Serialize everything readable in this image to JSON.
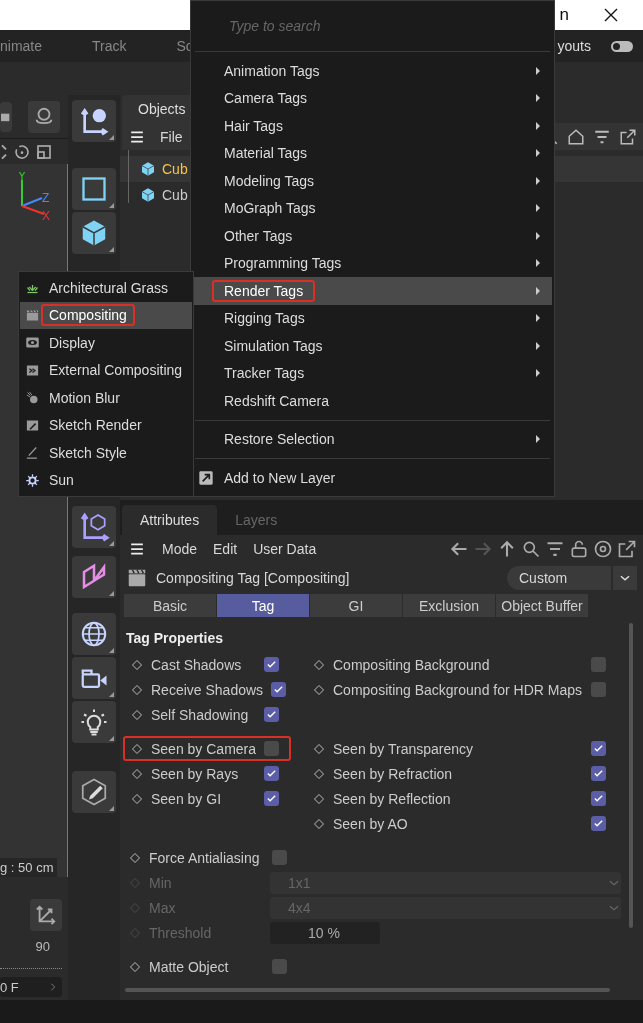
{
  "window": {
    "title": "n"
  },
  "menu_bar": {
    "items": [
      "nimate",
      "Track",
      "Sc"
    ],
    "right_label": "youts",
    "toggle": {
      "on": false
    }
  },
  "viewport": {
    "axis_labels": [
      "Y",
      "Z",
      "X"
    ],
    "grid_label": "g : 50 cm"
  },
  "timeline": {
    "tick_label": "90",
    "frame_field": "0 F"
  },
  "objects_panel": {
    "tab": "Objects",
    "menu": [
      "File"
    ],
    "objects": [
      {
        "name": "Cub",
        "selected": true
      },
      {
        "name": "Cub",
        "selected": false
      }
    ]
  },
  "context_menu": {
    "placeholder": "Type to search",
    "items": [
      {
        "kind": "submenu",
        "label": "Animation Tags",
        "selected": false,
        "annotated": false
      },
      {
        "kind": "submenu",
        "label": "Camera Tags",
        "selected": false,
        "annotated": false
      },
      {
        "kind": "submenu",
        "label": "Hair Tags",
        "selected": false,
        "annotated": false
      },
      {
        "kind": "submenu",
        "label": "Material Tags",
        "selected": false,
        "annotated": false
      },
      {
        "kind": "submenu",
        "label": "Modeling Tags",
        "selected": false,
        "annotated": false
      },
      {
        "kind": "submenu",
        "label": "MoGraph Tags",
        "selected": false,
        "annotated": false
      },
      {
        "kind": "submenu",
        "label": "Other Tags",
        "selected": false,
        "annotated": false
      },
      {
        "kind": "submenu",
        "label": "Programming Tags",
        "selected": false,
        "annotated": false
      },
      {
        "kind": "submenu",
        "label": "Render Tags",
        "selected": true,
        "annotated": true
      },
      {
        "kind": "submenu",
        "label": "Rigging Tags",
        "selected": false,
        "annotated": false
      },
      {
        "kind": "submenu",
        "label": "Simulation Tags",
        "selected": false,
        "annotated": false
      },
      {
        "kind": "submenu",
        "label": "Tracker Tags",
        "selected": false,
        "annotated": false
      },
      {
        "kind": "action",
        "label": "Redshift Camera",
        "selected": false,
        "annotated": false
      },
      {
        "kind": "separator"
      },
      {
        "kind": "submenu",
        "label": "Restore Selection",
        "selected": false,
        "annotated": false
      },
      {
        "kind": "separator"
      },
      {
        "kind": "action",
        "label": "Add to New Layer",
        "selected": false,
        "annotated": false
      }
    ]
  },
  "render_submenu": {
    "items": [
      {
        "label": "Architectural Grass",
        "selected": false,
        "annotated": false
      },
      {
        "label": "Compositing",
        "selected": true,
        "annotated": true
      },
      {
        "label": "Display",
        "selected": false,
        "annotated": false
      },
      {
        "label": "External Compositing",
        "selected": false,
        "annotated": false
      },
      {
        "label": "Motion Blur",
        "selected": false,
        "annotated": false
      },
      {
        "label": "Sketch Render",
        "selected": false,
        "annotated": false
      },
      {
        "label": "Sketch Style",
        "selected": false,
        "annotated": false
      },
      {
        "label": "Sun",
        "selected": false,
        "annotated": false
      }
    ]
  },
  "attributes_panel": {
    "tabs": [
      {
        "label": "Attributes",
        "selected": true
      },
      {
        "label": "Layers",
        "selected": false
      }
    ],
    "menu": [
      "Mode",
      "Edit",
      "User Data"
    ],
    "title": "Compositing Tag [Compositing]",
    "preset": "Custom",
    "page_tabs": [
      {
        "label": "Basic",
        "selected": false
      },
      {
        "label": "Tag",
        "selected": true
      },
      {
        "label": "GI",
        "selected": false
      },
      {
        "label": "Exclusion",
        "selected": false
      },
      {
        "label": "Object Buffer",
        "selected": false
      }
    ],
    "section_title": "Tag Properties",
    "sections": [
      {
        "rows": [
          {
            "left": {
              "kind": "checkbox",
              "label": "Cast Shadows",
              "checked": true,
              "annotated": false
            },
            "right": {
              "kind": "checkbox",
              "label": "Compositing Background",
              "checked": false,
              "annotated": false
            }
          },
          {
            "left": {
              "kind": "checkbox",
              "label": "Receive Shadows",
              "checked": true,
              "annotated": false
            },
            "right": {
              "kind": "checkbox",
              "label": "Compositing Background for HDR Maps",
              "checked": false,
              "annotated": false
            }
          },
          {
            "left": {
              "kind": "checkbox",
              "label": "Self Shadowing",
              "checked": true,
              "annotated": false
            }
          }
        ]
      },
      {
        "rows": [
          {
            "left": {
              "kind": "checkbox",
              "label": "Seen by Camera",
              "checked": false,
              "annotated": true
            },
            "right": {
              "kind": "checkbox",
              "label": "Seen by Transparency",
              "checked": true,
              "annotated": false
            }
          },
          {
            "left": {
              "kind": "checkbox",
              "label": "Seen by Rays",
              "checked": true,
              "annotated": false
            },
            "right": {
              "kind": "checkbox",
              "label": "Seen by Refraction",
              "checked": true,
              "annotated": false
            }
          },
          {
            "left": {
              "kind": "checkbox",
              "label": "Seen by GI",
              "checked": true,
              "annotated": false
            },
            "right": {
              "kind": "checkbox",
              "label": "Seen by Reflection",
              "checked": true,
              "annotated": false
            }
          },
          {
            "right": {
              "kind": "checkbox",
              "label": "Seen by AO",
              "checked": true,
              "annotated": false
            }
          }
        ]
      },
      {
        "rows": [
          {
            "left": {
              "kind": "checkbox",
              "label": "Force Antialiasing",
              "checked": false,
              "annotated": false,
              "disabled": false
            }
          },
          {
            "left": {
              "kind": "dropdown",
              "label": "Min",
              "value": "1x1",
              "annotated": false,
              "disabled": true
            }
          },
          {
            "left": {
              "kind": "dropdown",
              "label": "Max",
              "value": "4x4",
              "annotated": false,
              "disabled": true
            }
          },
          {
            "left": {
              "kind": "number",
              "label": "Threshold",
              "value": "10 %",
              "annotated": false,
              "disabled": true
            }
          }
        ]
      },
      {
        "rows": [
          {
            "left": {
              "kind": "checkbox",
              "label": "Matte Object",
              "checked": false,
              "annotated": false,
              "disabled": false
            }
          }
        ]
      }
    ]
  }
}
